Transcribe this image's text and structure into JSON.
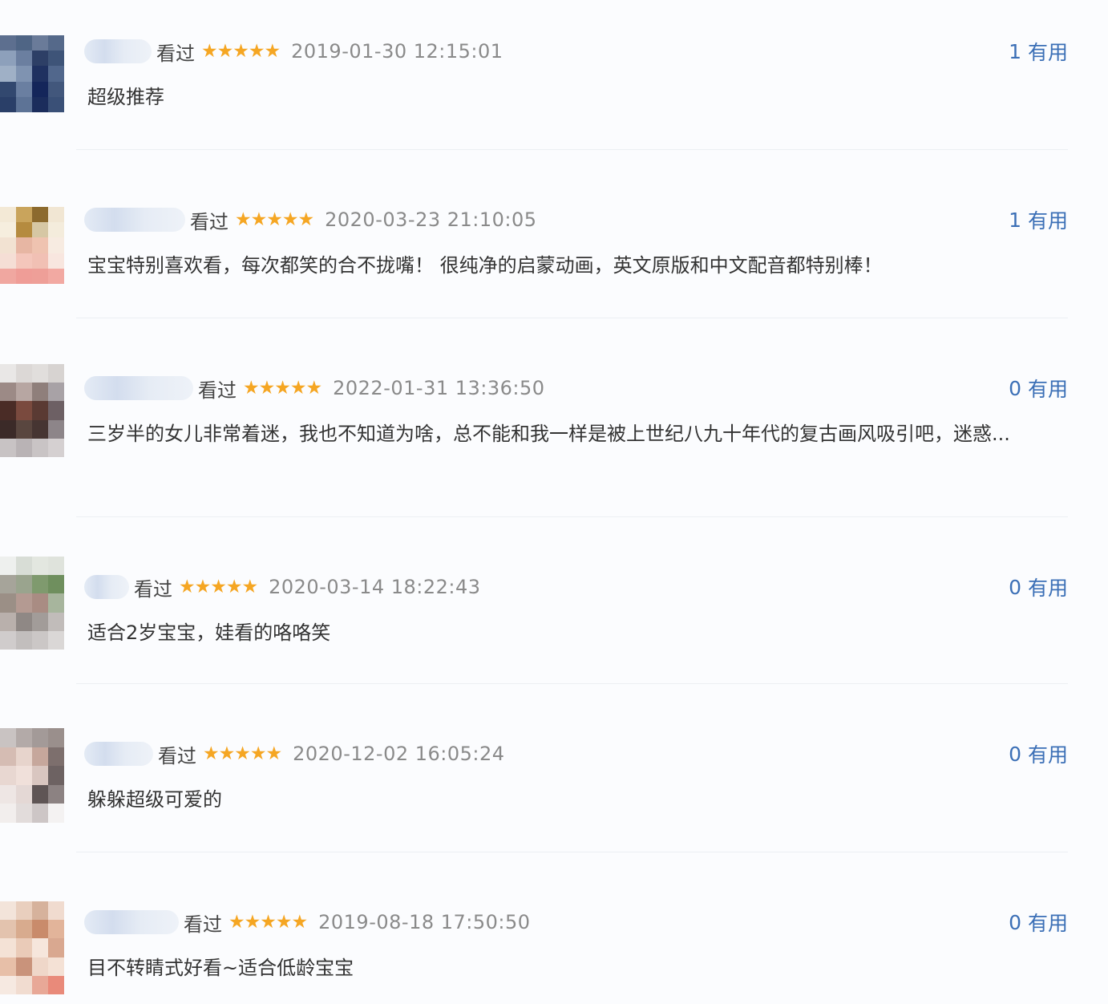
{
  "watched_label": "看过",
  "useful_label": "有用",
  "star_color": "#f5a623",
  "reviews": [
    {
      "rating": 5,
      "time": "2019-01-30 12:15:01",
      "useful_count": "1",
      "content": "超级推荐"
    },
    {
      "rating": 5,
      "time": "2020-03-23 21:10:05",
      "useful_count": "1",
      "content": "宝宝特别喜欢看，每次都笑的合不拢嘴！ 很纯净的启蒙动画，英文原版和中文配音都特别棒！"
    },
    {
      "rating": 5,
      "time": "2022-01-31 13:36:50",
      "useful_count": "0",
      "content": "三岁半的女儿非常着迷，我也不知道为啥，总不能和我一样是被上世纪八九十年代的复古画风吸引吧，迷惑..."
    },
    {
      "rating": 5,
      "time": "2020-03-14 18:22:43",
      "useful_count": "0",
      "content": "适合2岁宝宝，娃看的咯咯笑"
    },
    {
      "rating": 5,
      "time": "2020-12-02 16:05:24",
      "useful_count": "0",
      "content": "躲躲超级可爱的"
    },
    {
      "rating": 5,
      "time": "2019-08-18 17:50:50",
      "useful_count": "0",
      "content": "目不转睛式好看~适合低龄宝宝"
    }
  ]
}
